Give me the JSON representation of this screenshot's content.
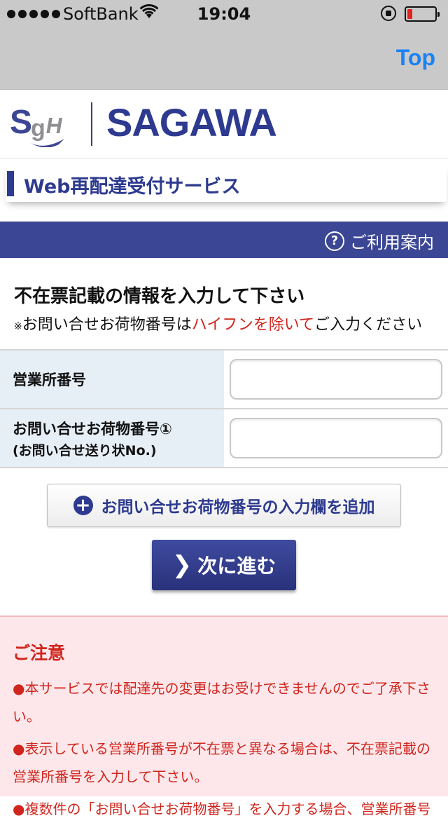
{
  "status_bar": {
    "carrier": "SoftBank",
    "time": "19:04",
    "icons": [
      "signal-dots",
      "wifi-icon",
      "rotation-lock-icon",
      "battery-icon"
    ]
  },
  "nav": {
    "top_link": "Top"
  },
  "brand": {
    "logo_text": "SgH",
    "company_name": "SAGAWA"
  },
  "service": {
    "title": "Web再配達受付サービス"
  },
  "guide": {
    "label": "ご利用案内",
    "icon": "help-icon"
  },
  "instructions": {
    "title": "不在票記載の情報を入力して下さい",
    "note_mark": "※",
    "note_pre": "お問い合せお荷物番号は",
    "note_red": "ハイフンを除いて",
    "note_post": "ご入力ください"
  },
  "form": {
    "fields": [
      {
        "label": "営業所番号",
        "sublabel": "",
        "value": ""
      },
      {
        "label": "お問い合せお荷物番号①",
        "sublabel": "(お問い合せ送り状No.)",
        "value": ""
      }
    ]
  },
  "buttons": {
    "add_label": "お問い合せお荷物番号の入力欄を追加",
    "next_label": "次に進む"
  },
  "notice": {
    "title": "ご注意",
    "items": [
      "●本サービスでは配達先の変更はお受けできませんのでご了承下さい。",
      "●表示している営業所番号が不在票と異なる場合は、不在票記載の営業所番号を入力して下さい。",
      "●複数件の「お問い合せお荷物番号」を入力する場合、営業所番号"
    ]
  },
  "colors": {
    "brand_navy": "#2d3a8f",
    "guide_bar": "#3b4694",
    "link_blue": "#1a82f7",
    "warning_red": "#d0261e",
    "notice_bg": "#fde7ea"
  }
}
